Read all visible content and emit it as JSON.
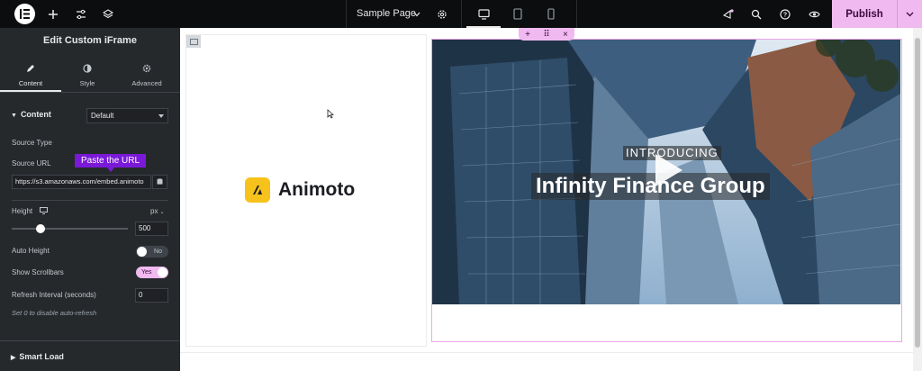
{
  "topbar": {
    "page_name": "Sample Page",
    "publish_label": "Publish",
    "icons": [
      "elementor-logo-icon",
      "plus-icon",
      "sliders-icon",
      "layers-icon",
      "chevron-down-icon",
      "gear-icon",
      "desktop-icon",
      "tablet-icon",
      "mobile-icon",
      "notifications-icon",
      "search-icon",
      "help-icon",
      "eye-icon",
      "chevron-down-icon"
    ]
  },
  "panel": {
    "title": "Edit Custom iFrame",
    "tabs": [
      {
        "label": "Content",
        "icon": "pencil-icon",
        "active": true
      },
      {
        "label": "Style",
        "icon": "contrast-icon",
        "active": false
      },
      {
        "label": "Advanced",
        "icon": "gear-icon",
        "active": false
      }
    ],
    "section_content": "Content",
    "source_type_label": "Source Type",
    "source_type_value": "Default",
    "source_url_label": "Source URL",
    "tooltip": "Paste the URL",
    "source_url_value": "https://s3.amazonaws.com/embed.animoto",
    "height_label": "Height",
    "height_unit": "px",
    "height_value": "500",
    "height_slider_fraction": 0.2,
    "auto_height_label": "Auto Height",
    "auto_height_state": "No",
    "show_scrollbars_label": "Show Scrollbars",
    "show_scrollbars_state": "Yes",
    "refresh_label": "Refresh Interval (seconds)",
    "refresh_value": "0",
    "refresh_hint": "Set 0 to disable auto-refresh",
    "section_smart_load": "Smart Load"
  },
  "canvas": {
    "logo_text": "Animoto",
    "video_tag": "INTRODUCING",
    "video_title": "Infinity Finance Group",
    "section_controls": [
      "+",
      "⠿",
      "×"
    ]
  },
  "colors": {
    "accent": "#f0b9f0",
    "panel_bg": "#26292c",
    "tooltip": "#7a19d8",
    "animoto_yellow": "#f6c21b"
  }
}
